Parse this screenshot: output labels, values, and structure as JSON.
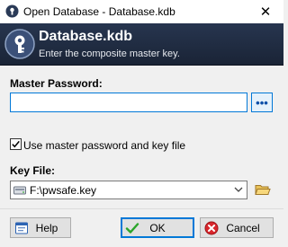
{
  "window": {
    "title": "Open Database - Database.kdb",
    "close_symbol": "✕"
  },
  "banner": {
    "title": "Database.kdb",
    "subtitle": "Enter the composite master key."
  },
  "master_password": {
    "label": "Master Password:",
    "value": "",
    "reveal_button_label": "•••"
  },
  "use_keyfile": {
    "label": "Use master password and key file",
    "checked": true
  },
  "key_file": {
    "label": "Key File:",
    "selected_value": "F:\\pwsafe.key"
  },
  "buttons": {
    "help": "Help",
    "ok": "OK",
    "cancel": "Cancel"
  },
  "colors": {
    "banner": "#1f2b40",
    "focus_accent": "#0078d7"
  }
}
